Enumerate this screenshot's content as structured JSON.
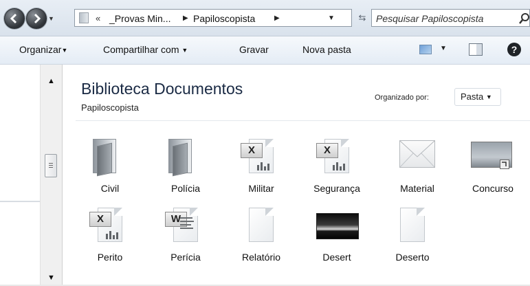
{
  "address": {
    "path_chevron": "«",
    "breadcrumbs": [
      "_Provas Min...",
      "Papiloscopista"
    ],
    "search_placeholder": "Pesquisar Papiloscopista"
  },
  "toolbar": {
    "organize": "Organizar",
    "share": "Compartilhar com",
    "burn": "Gravar",
    "new_folder": "Nova pasta"
  },
  "library": {
    "title": "Biblioteca Documentos",
    "subtitle": "Papiloscopista",
    "arrange_label": "Organizado por:",
    "arrange_value": "Pasta"
  },
  "items": [
    {
      "name": "Civil",
      "icon": "folder-icon"
    },
    {
      "name": "Polícia",
      "icon": "folder-icon"
    },
    {
      "name": "Militar",
      "icon": "excel-file-icon"
    },
    {
      "name": "Segurança",
      "icon": "excel-file-icon"
    },
    {
      "name": "Material",
      "icon": "email-envelope-icon"
    },
    {
      "name": "Concurso",
      "icon": "image-file-icon"
    },
    {
      "name": "Perito",
      "icon": "excel-file-icon"
    },
    {
      "name": "Perícia",
      "icon": "word-file-icon"
    },
    {
      "name": "Relatório",
      "icon": "blank-file-icon"
    },
    {
      "name": "Desert",
      "icon": "desert-image-icon"
    },
    {
      "name": "Deserto",
      "icon": "blank-file-icon"
    }
  ]
}
